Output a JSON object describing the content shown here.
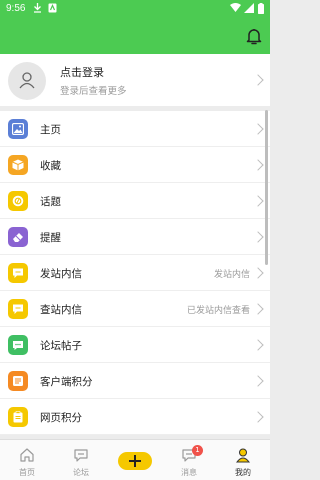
{
  "status_bar": {
    "time": "9:56"
  },
  "profile": {
    "title": "点击登录",
    "subtitle": "登录后查看更多"
  },
  "menu": [
    {
      "label": "主页",
      "value": "",
      "icon": "image-icon",
      "color": "#5b7fd6"
    },
    {
      "label": "收藏",
      "value": "",
      "icon": "box-icon",
      "color": "#f5a623"
    },
    {
      "label": "话题",
      "value": "",
      "icon": "topic-icon",
      "color": "#f5c800"
    },
    {
      "label": "提醒",
      "value": "",
      "icon": "eraser-icon",
      "color": "#8a63d2"
    },
    {
      "label": "发站内信",
      "value": "发站内信",
      "icon": "message-icon",
      "color": "#f5c800"
    },
    {
      "label": "查站内信",
      "value": "已发站内信查看",
      "icon": "message-icon",
      "color": "#f5c800"
    },
    {
      "label": "论坛帖子",
      "value": "",
      "icon": "chat-icon",
      "color": "#3fbf63"
    },
    {
      "label": "客户端积分",
      "value": "",
      "icon": "points-icon",
      "color": "#f58a23"
    },
    {
      "label": "网页积分",
      "value": "",
      "icon": "clipboard-icon",
      "color": "#f5c800"
    }
  ],
  "bottom_nav": {
    "home": "首页",
    "forum": "论坛",
    "messages": "消息",
    "mine": "我的",
    "messages_badge": "1"
  }
}
